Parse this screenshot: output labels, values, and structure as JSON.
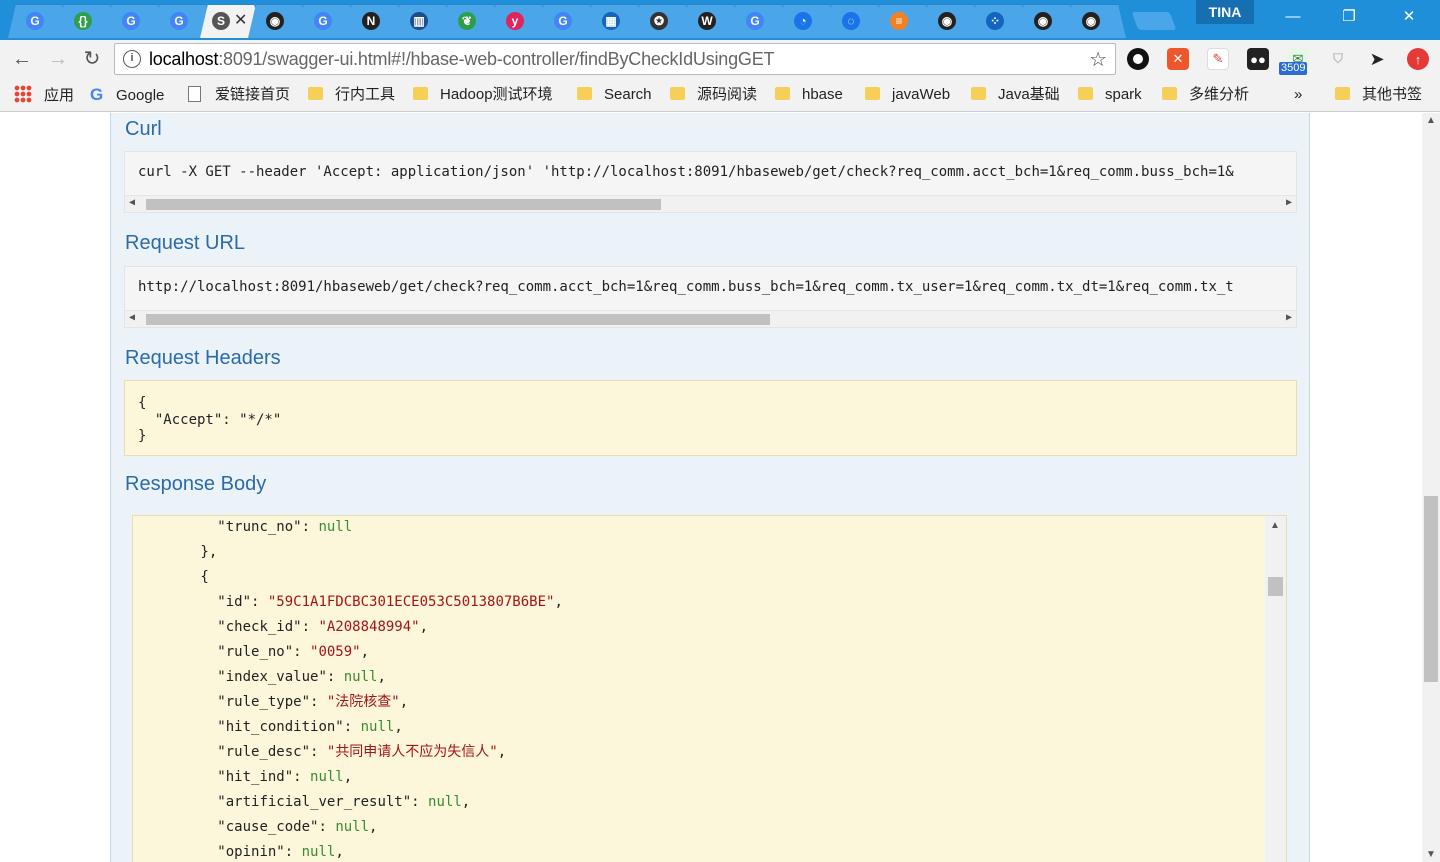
{
  "window": {
    "user": "TINA",
    "minimize": "—",
    "restore": "❐",
    "close": "✕"
  },
  "tabs": [
    {
      "icon": "google-icon",
      "glyph": "G",
      "color": "#4285f4"
    },
    {
      "icon": "circle-logo-icon",
      "glyph": "{}",
      "color": "#2e9e4a"
    },
    {
      "icon": "google-icon",
      "glyph": "G",
      "color": "#4285f4"
    },
    {
      "icon": "google-icon",
      "glyph": "G",
      "color": "#4285f4"
    },
    {
      "icon": "swagger-icon",
      "glyph": "S",
      "color": "#555555",
      "active": true
    },
    {
      "icon": "github-icon",
      "glyph": "◉",
      "color": "#222222"
    },
    {
      "icon": "google-icon",
      "glyph": "G",
      "color": "#4285f4"
    },
    {
      "icon": "n-logo-icon",
      "glyph": "N",
      "color": "#222222"
    },
    {
      "icon": "book-icon",
      "glyph": "▥",
      "color": "#1c4f8a"
    },
    {
      "icon": "spring-icon",
      "glyph": "❦",
      "color": "#2e9e4a"
    },
    {
      "icon": "y-logo-icon",
      "glyph": "y",
      "color": "#e0245e"
    },
    {
      "icon": "google-icon",
      "glyph": "G",
      "color": "#4285f4"
    },
    {
      "icon": "film-icon",
      "glyph": "▦",
      "color": "#1565c0"
    },
    {
      "icon": "rocket-icon",
      "glyph": "✪",
      "color": "#333333"
    },
    {
      "icon": "wikipedia-icon",
      "glyph": "W",
      "color": "#222222"
    },
    {
      "icon": "google-icon",
      "glyph": "G",
      "color": "#4285f4"
    },
    {
      "icon": "loading-icon",
      "glyph": "◔",
      "color": "#1a73e8"
    },
    {
      "icon": "loading-icon",
      "glyph": "◌",
      "color": "#1a73e8"
    },
    {
      "icon": "stackoverflow-icon",
      "glyph": "≡",
      "color": "#f48024"
    },
    {
      "icon": "github-icon",
      "glyph": "◉",
      "color": "#222222"
    },
    {
      "icon": "dots-icon",
      "glyph": "⁘",
      "color": "#1565c0"
    },
    {
      "icon": "github-icon",
      "glyph": "◉",
      "color": "#222222"
    },
    {
      "icon": "github-icon",
      "glyph": "◉",
      "color": "#222222"
    }
  ],
  "toolbar": {
    "url_host": "localhost",
    "url_rest": ":8091/swagger-ui.html#!/hbase-web-controller/findByCheckIdUsingGET",
    "badge": "3509"
  },
  "bookmarks": [
    {
      "kind": "apps",
      "label": "应用"
    },
    {
      "kind": "google",
      "label": "Google"
    },
    {
      "kind": "page",
      "label": "爱链接首页"
    },
    {
      "kind": "folder",
      "label": "行内工具"
    },
    {
      "kind": "folder",
      "label": "Hadoop测试环境"
    },
    {
      "kind": "folder",
      "label": "Search"
    },
    {
      "kind": "folder",
      "label": "源码阅读"
    },
    {
      "kind": "folder",
      "label": "hbase"
    },
    {
      "kind": "folder",
      "label": "javaWeb"
    },
    {
      "kind": "folder",
      "label": "Java基础"
    },
    {
      "kind": "folder",
      "label": "spark"
    },
    {
      "kind": "folder",
      "label": "多维分析"
    }
  ],
  "bookmarks_more": "»",
  "bookmarks_other": "其他书签",
  "sections": {
    "curl_title": "Curl",
    "curl_text": "curl -X GET --header 'Accept: application/json' 'http://localhost:8091/hbaseweb/get/check?req_comm.acct_bch=1&req_comm.buss_bch=1&",
    "request_url_title": "Request URL",
    "request_url_text": "http://localhost:8091/hbaseweb/get/check?req_comm.acct_bch=1&req_comm.buss_bch=1&req_comm.tx_user=1&req_comm.tx_dt=1&req_comm.tx_t",
    "request_headers_title": "Request Headers",
    "request_headers_line1": "{",
    "request_headers_line2": "  \"Accept\": \"*/*\"",
    "request_headers_line3": "}",
    "response_body_title": "Response Body"
  },
  "response_body": [
    {
      "indent": "        ",
      "key": "\"trunc_no\"",
      "value": "null",
      "type": "n",
      "comma": ""
    },
    {
      "indent": "      ",
      "raw": "},"
    },
    {
      "indent": "      ",
      "raw": "{"
    },
    {
      "indent": "        ",
      "key": "\"id\"",
      "value": "\"59C1A1FDCBC301ECE053C5013807B6BE\"",
      "type": "s",
      "comma": ","
    },
    {
      "indent": "        ",
      "key": "\"check_id\"",
      "value": "\"A208848994\"",
      "type": "s",
      "comma": ","
    },
    {
      "indent": "        ",
      "key": "\"rule_no\"",
      "value": "\"0059\"",
      "type": "s",
      "comma": ","
    },
    {
      "indent": "        ",
      "key": "\"index_value\"",
      "value": "null",
      "type": "n",
      "comma": ","
    },
    {
      "indent": "        ",
      "key": "\"rule_type\"",
      "value": "\"法院核查\"",
      "type": "s",
      "comma": ","
    },
    {
      "indent": "        ",
      "key": "\"hit_condition\"",
      "value": "null",
      "type": "n",
      "comma": ","
    },
    {
      "indent": "        ",
      "key": "\"rule_desc\"",
      "value": "\"共同申请人不应为失信人\"",
      "type": "s",
      "comma": ","
    },
    {
      "indent": "        ",
      "key": "\"hit_ind\"",
      "value": "null",
      "type": "n",
      "comma": ","
    },
    {
      "indent": "        ",
      "key": "\"artificial_ver_result\"",
      "value": "null",
      "type": "n",
      "comma": ","
    },
    {
      "indent": "        ",
      "key": "\"cause_code\"",
      "value": "null",
      "type": "n",
      "comma": ","
    },
    {
      "indent": "        ",
      "key": "\"opinin\"",
      "value": "null",
      "type": "n",
      "comma": ","
    }
  ]
}
